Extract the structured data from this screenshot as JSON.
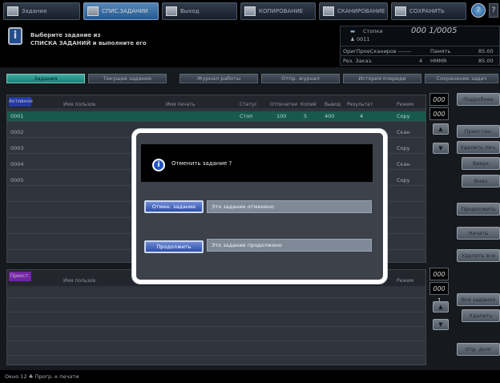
{
  "top_tabs": [
    {
      "label": "Задания",
      "icon": "machine-icon",
      "active": false
    },
    {
      "label": "СПИС.ЗАДАНИЙ",
      "icon": "list-icon",
      "active": true
    },
    {
      "label": "Выход",
      "icon": "output-icon",
      "active": false
    },
    {
      "label": "КОПИРОВАНИЕ",
      "icon": "copy-icon",
      "active": false
    },
    {
      "label": "СКАНИРОВАНИЕ",
      "icon": "scan-icon",
      "active": false
    },
    {
      "label": "СОХРАНИТЬ",
      "icon": "store-icon",
      "active": false
    }
  ],
  "message": {
    "line1": "Выберите задание из",
    "line2": "СПИСКА ЗАДАНИЙ и выполните его"
  },
  "status": {
    "copies_label": "Стопки",
    "copies_value": "000 1/0005",
    "jobs_value": "0011",
    "row2_left": "ОригПроеСканиров -------",
    "row2_right_label": "Память",
    "row2_right_value": "85.00",
    "row3_left": "Рез. Заказ.",
    "row3_mid": "4",
    "row3_right_label": "HMMR",
    "row3_right_value": "85.00"
  },
  "sub_tabs": [
    "Задания",
    "Текущее задание",
    "Журнал работы",
    "Отпр. журнал",
    "История очереди",
    "Сохранение задач"
  ],
  "active_table": {
    "badge": "Активное",
    "columns": [
      "Имя пользов.",
      "Имя печать",
      "Статус",
      "Отпечатки",
      "Копий",
      "Вывод",
      "Результат",
      "Режим"
    ],
    "rows": [
      {
        "id": "0001",
        "status": "Стоп",
        "printed": "100",
        "copies": "5",
        "output": "400",
        "result": "4",
        "mode": "Copy",
        "selected": true
      },
      {
        "id": "0002",
        "status": "",
        "printed": "",
        "copies": "",
        "output": "",
        "result": "",
        "mode": "Скан",
        "selected": false
      },
      {
        "id": "0003",
        "status": "",
        "printed": "",
        "copies": "",
        "output": "",
        "result": "",
        "mode": "Copy",
        "selected": false
      },
      {
        "id": "0004",
        "status": "",
        "printed": "",
        "copies": "",
        "output": "",
        "result": "",
        "mode": "Скан",
        "selected": false
      },
      {
        "id": "0005",
        "status": "",
        "printed": "",
        "copies": "",
        "output": "",
        "result": "",
        "mode": "Copy",
        "selected": false
      }
    ]
  },
  "right_panel": {
    "counter_a": "000 1",
    "counter_b": "000 1",
    "buttons": [
      "Подробнее",
      "Приостан.",
      "Удалить печ.",
      "Вверх",
      "Вниз",
      "Продолжить",
      "Начать",
      "Удалить все"
    ],
    "counter_c": "000 1",
    "counter_d": "000 1",
    "buttons2": [
      "Все задания",
      "Удалить",
      "Отр. долг"
    ]
  },
  "hold_table": {
    "badge": "Приост.",
    "columns": [
      "Имя пользов.",
      "Режим"
    ]
  },
  "bottom_bar": {
    "text": "Окно 12  ♣ Прогр. к печати"
  },
  "dialog": {
    "question": "Отменить задание ?",
    "cancel_button": "Отмен. задание",
    "cancel_desc": "Это задание отменено",
    "continue_button": "Продолжить",
    "continue_desc": "Это задание продолжено"
  }
}
